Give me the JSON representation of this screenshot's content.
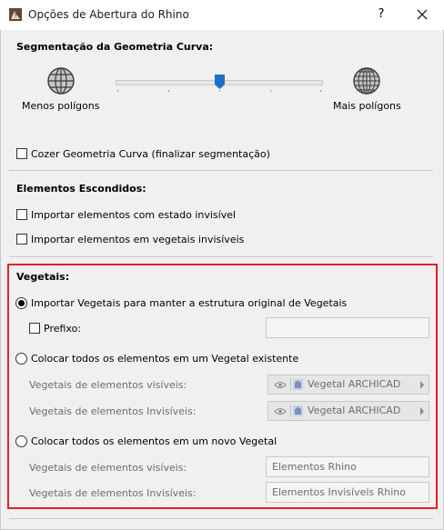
{
  "window": {
    "title": "Opções de Abertura do Rhino",
    "help_label": "?",
    "colors": {
      "highlight_border": "#e41f25",
      "slider_thumb": "#1f6fc7"
    }
  },
  "segmentation": {
    "title": "Segmentação da Geometria Curva:",
    "fewer_label": "Menos polígons",
    "more_label": "Mais polígons",
    "slider_value_fraction": 0.5,
    "stitch_label": "Cozer Geometria Curva (finalizar segmentação)",
    "stitch_checked": false
  },
  "hidden": {
    "title": "Elementos Escondidos:",
    "items": [
      {
        "label": "Importar elementos com estado invisível",
        "checked": false
      },
      {
        "label": "Importar elementos em vegetais invisíveis",
        "checked": false
      }
    ]
  },
  "layers": {
    "title": "Vegetais:",
    "option1": {
      "label": "Importar Vegetais para manter a estrutura original de Vegetais",
      "selected": true
    },
    "prefix": {
      "label": "Prefixo:",
      "checked": false,
      "value": ""
    },
    "option2": {
      "label": "Colocar todos os elementos em um Vegetal existente",
      "selected": false
    },
    "existing_visible": {
      "label": "Vegetais de elementos visíveis:",
      "value": "Vegetal ARCHICAD"
    },
    "existing_invisible": {
      "label": "Vegetais de elementos Invisíveis:",
      "value": "Vegetal ARCHICAD"
    },
    "option3": {
      "label": "Colocar todos os elementos em um novo Vegetal",
      "selected": false
    },
    "new_visible": {
      "label": "Vegetais de elementos visíveis:",
      "value": "Elementos Rhino"
    },
    "new_invisible": {
      "label": "Vegetais de elementos Invisíveis:",
      "value": "Elementos Invisíveis Rhino"
    }
  }
}
